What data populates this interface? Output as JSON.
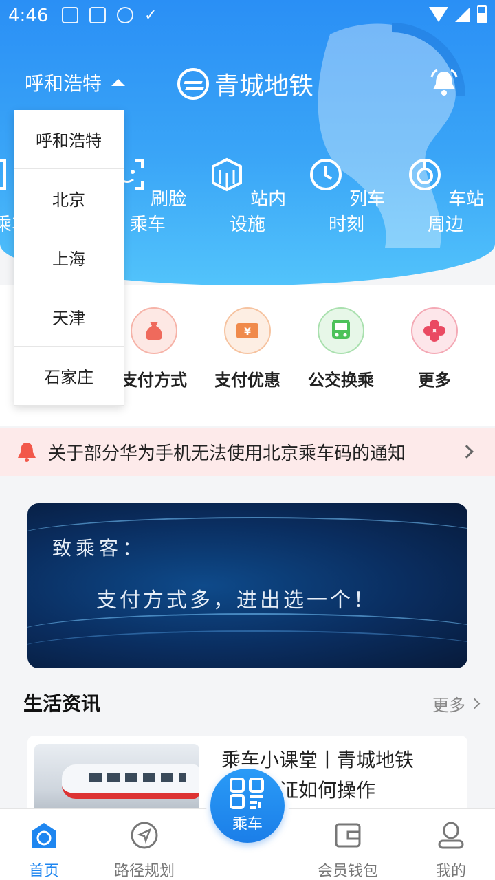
{
  "status": {
    "time": "4:46"
  },
  "header": {
    "city": "呼和浩特",
    "app_title": "青城地铁"
  },
  "city_dropdown": {
    "options": [
      "呼和浩特",
      "北京",
      "上海",
      "天津",
      "石家庄"
    ]
  },
  "quick_actions": [
    {
      "label": "扫码乘车",
      "icon": "scan-icon"
    },
    {
      "label": "刷脸乘车",
      "icon": "face-scan-icon"
    },
    {
      "label": "站内设施",
      "icon": "facility-icon"
    },
    {
      "label": "列车时刻",
      "icon": "clock-icon"
    },
    {
      "label": "车站周边",
      "icon": "nearby-icon"
    }
  ],
  "services": [
    {
      "label": "支付方式",
      "icon": "money-bag-icon",
      "color": "#ef6a5c"
    },
    {
      "label": "支付优惠",
      "icon": "coupon-icon",
      "color": "#f08a4b"
    },
    {
      "label": "公交换乘",
      "icon": "bus-icon",
      "color": "#4cc25a"
    },
    {
      "label": "更多",
      "icon": "more-icon",
      "color": "#ea4a62"
    }
  ],
  "notice": {
    "text": "关于部分华为手机无法使用北京乘车码的通知"
  },
  "banner": {
    "line1": "致乘客：",
    "line2": "支付方式多，进出选一个！"
  },
  "news": {
    "title": "生活资讯",
    "more": "更多",
    "items": [
      {
        "title_line1": "乘车小课堂丨青城地铁",
        "title_line2": "实名认证如何操作"
      }
    ]
  },
  "bottom_nav": {
    "home": "首页",
    "route": "路径规划",
    "ride": "乘车",
    "wallet": "会员钱包",
    "mine": "我的"
  },
  "colors": {
    "primary": "#1e86f0",
    "notice_bg": "#fdeaea"
  }
}
